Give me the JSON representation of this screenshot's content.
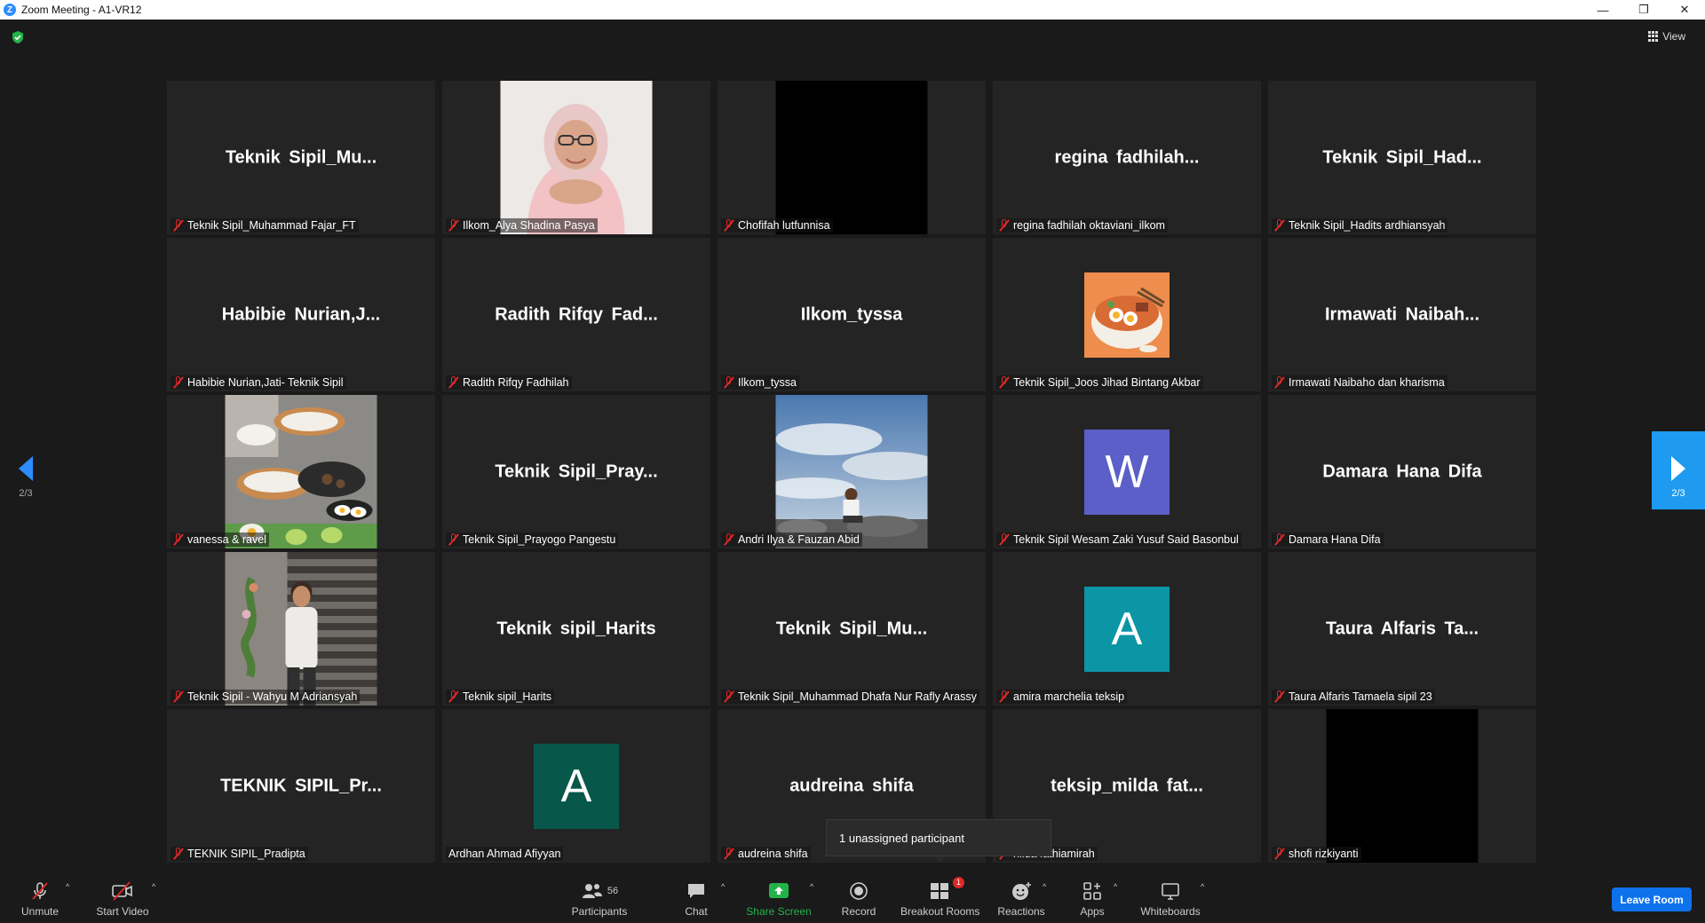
{
  "window": {
    "title": "Zoom Meeting - A1-VR12",
    "minimize": "—",
    "restore": "❐",
    "close": "✕"
  },
  "top": {
    "view_label": "View"
  },
  "nav": {
    "prev_page": "2/3",
    "next_page": "2/3"
  },
  "tiles": [
    {
      "name_center": "Teknik  Sipil_Mu...",
      "label": "Teknik Sipil_Muhammad Fajar_FT",
      "muted": true,
      "kind": "text"
    },
    {
      "name_center": "",
      "label": "Ilkom_Alya Shadina Pasya",
      "muted": true,
      "kind": "video",
      "video": "woman-hijab"
    },
    {
      "name_center": "",
      "label": "Chofifah lutfunnisa",
      "muted": true,
      "kind": "video",
      "video": "black"
    },
    {
      "name_center": "regina  fadhilah...",
      "label": "regina fadhilah oktaviani_ilkom",
      "muted": true,
      "kind": "text"
    },
    {
      "name_center": "Teknik  Sipil_Had...",
      "label": "Teknik Sipil_Hadits ardhiansyah",
      "muted": true,
      "kind": "text"
    },
    {
      "name_center": "Habibie  Nurian,J...",
      "label": "Habibie Nurian,Jati- Teknik Sipil",
      "muted": true,
      "kind": "text"
    },
    {
      "name_center": "Radith  Rifqy  Fad...",
      "label": "Radith Rifqy Fadhilah",
      "muted": true,
      "kind": "text"
    },
    {
      "name_center": "Ilkom_tyssa",
      "label": "Ilkom_tyssa",
      "muted": true,
      "kind": "text"
    },
    {
      "name_center": "",
      "label": "Teknik Sipil_Joos Jihad Bintang Akbar",
      "muted": true,
      "kind": "image",
      "image": "ramen-bowl"
    },
    {
      "name_center": "Irmawati  Naibah...",
      "label": "Irmawati Naibaho dan kharisma",
      "muted": true,
      "kind": "text"
    },
    {
      "name_center": "",
      "label": "vanessa & ravel",
      "muted": true,
      "kind": "video",
      "video": "cooking-scene"
    },
    {
      "name_center": "Teknik  Sipil_Pray...",
      "label": "Teknik Sipil_Prayogo Pangestu",
      "muted": true,
      "kind": "text"
    },
    {
      "name_center": "",
      "label": "Andri Ilya & Fauzan Abid",
      "muted": true,
      "kind": "video",
      "video": "sky-beach"
    },
    {
      "name_center": "",
      "label": "Teknik Sipil Wesam Zaki Yusuf Said Basonbul",
      "muted": true,
      "kind": "avatar",
      "avatar_letter": "W",
      "avatar_color": "#5b5fc7"
    },
    {
      "name_center": "Damara Hana Difa",
      "label": "Damara Hana Difa",
      "muted": true,
      "kind": "text"
    },
    {
      "name_center": "",
      "label": "Teknik Sipil - Wahyu M Adriansyah",
      "muted": true,
      "kind": "video",
      "video": "man-wall"
    },
    {
      "name_center": "Teknik sipil_Harits",
      "label": "Teknik sipil_Harits",
      "muted": true,
      "kind": "text"
    },
    {
      "name_center": "Teknik  Sipil_Mu...",
      "label": "Teknik Sipil_Muhammad Dhafa Nur Rafly Arassy",
      "muted": true,
      "kind": "text"
    },
    {
      "name_center": "",
      "label": "amira marchelia teksip",
      "muted": true,
      "kind": "avatar",
      "avatar_letter": "A",
      "avatar_color": "#0b95a5"
    },
    {
      "name_center": "Taura  Alfaris  Ta...",
      "label": "Taura Alfaris Tamaela sipil 23",
      "muted": true,
      "kind": "text"
    },
    {
      "name_center": "TEKNIK  SIPIL_Pr...",
      "label": "TEKNIK SIPIL_Pradipta",
      "muted": true,
      "kind": "text"
    },
    {
      "name_center": "",
      "label": "Ardhan Ahmad Afiyyan",
      "muted": false,
      "kind": "avatar",
      "avatar_letter": "A",
      "avatar_color": "#08574b"
    },
    {
      "name_center": "audreina shifa",
      "label": "audreina shifa",
      "muted": true,
      "kind": "text"
    },
    {
      "name_center": "teksip_milda  fat...",
      "label": "nilda fathiamirah",
      "muted": true,
      "kind": "text"
    },
    {
      "name_center": "",
      "label": "shofi rizkiyanti",
      "muted": true,
      "kind": "video",
      "video": "black"
    }
  ],
  "popup": {
    "text": "1 unassigned participant"
  },
  "toolbar": {
    "unmute": "Unmute",
    "start_video": "Start Video",
    "participants": "Participants",
    "participants_count": "56",
    "chat": "Chat",
    "share_screen": "Share Screen",
    "record": "Record",
    "breakout_rooms": "Breakout Rooms",
    "breakout_badge": "1",
    "reactions": "Reactions",
    "apps": "Apps",
    "whiteboards": "Whiteboards",
    "leave": "Leave Room"
  },
  "colors": {
    "accent": "#2d8cff",
    "leave": "#0e72ed",
    "mute_red": "#e02828",
    "share_green": "#23b34a"
  }
}
